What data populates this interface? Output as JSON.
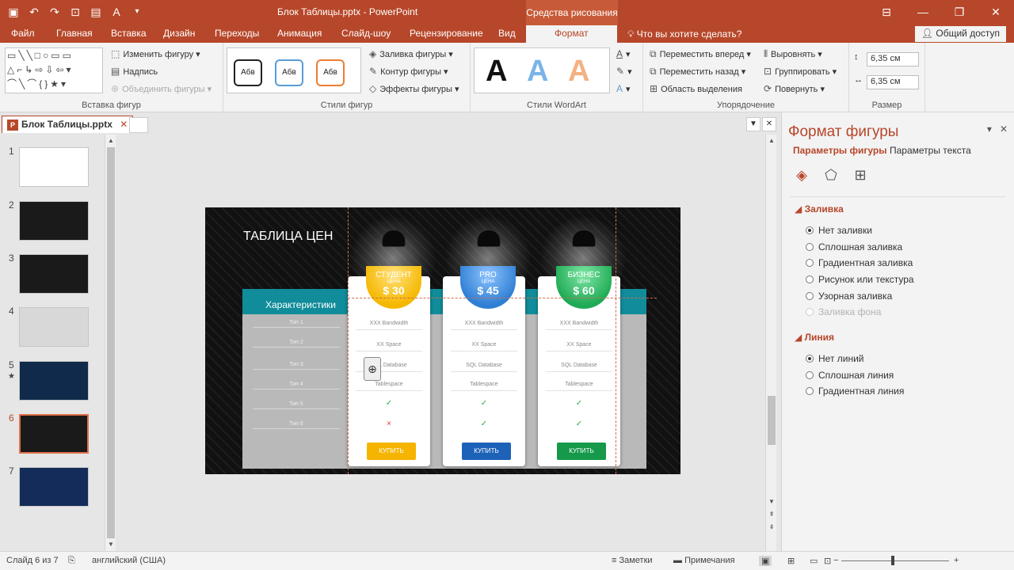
{
  "window": {
    "doc_title": "Блок Таблицы.pptx - PowerPoint",
    "context_group": "Средства рисования"
  },
  "tabs": [
    {
      "label": "Файл"
    },
    {
      "label": "Главная"
    },
    {
      "label": "Вставка"
    },
    {
      "label": "Дизайн"
    },
    {
      "label": "Переходы"
    },
    {
      "label": "Анимация"
    },
    {
      "label": "Слайд-шоу"
    },
    {
      "label": "Рецензирование"
    },
    {
      "label": "Вид"
    },
    {
      "label": "Формат"
    }
  ],
  "tellme": "Что вы хотите сделать?",
  "share": "Общий доступ",
  "ribbon": {
    "insert_shapes": {
      "edit_shape": "Изменить фигуру",
      "text_box": "Надпись",
      "merge_shapes": "Объединить фигуры",
      "label": "Вставка фигур"
    },
    "shape_styles": {
      "swatch_label": "Абв",
      "fill": "Заливка фигуры",
      "outline": "Контур фигуры",
      "effects": "Эффекты фигуры",
      "label": "Стили фигур"
    },
    "wordart": {
      "letter": "A",
      "label": "Стили WordArt"
    },
    "arrange": {
      "bring_forward": "Переместить вперед",
      "send_backward": "Переместить назад",
      "selection_pane": "Область выделения",
      "align": "Выровнять",
      "group": "Группировать",
      "rotate": "Повернуть",
      "label": "Упорядочение"
    },
    "size": {
      "height": "6,35 см",
      "width": "6,35 см",
      "label": "Размер"
    }
  },
  "file_tab": "Блок Таблицы.pptx",
  "thumbnails": [
    {
      "num": "1"
    },
    {
      "num": "2"
    },
    {
      "num": "3"
    },
    {
      "num": "4"
    },
    {
      "num": "5",
      "star": "★"
    },
    {
      "num": "6"
    },
    {
      "num": "7"
    }
  ],
  "slide": {
    "title": "ТАБЛИЦА ЦЕН",
    "features_header": "Характеристики",
    "feature_rows": [
      "Тип 1",
      "Тип 2",
      "Тип 3",
      "Тип 4",
      "Тип 5",
      "Тип 6"
    ],
    "card_lines": [
      "XXX Bandwidth",
      "XX Space",
      "SQL Database",
      "Tablespace"
    ],
    "check": "✓",
    "cross": "×",
    "price_label": "ЦЕНА",
    "plans": [
      {
        "name": "СТУДЕНТ",
        "price": "$ 30",
        "button": "КУПИТЬ",
        "color": "#f5b800",
        "button_color": "#f5b400"
      },
      {
        "name": "PRO",
        "price": "$ 45",
        "button": "КУПИТЬ",
        "color": "#2f7fd4",
        "button_color": "#1d62b8"
      },
      {
        "name": "БИЗНЕС",
        "price": "$ 60",
        "button": "КУПИТЬ",
        "color": "#1faa55",
        "button_color": "#16994a"
      }
    ]
  },
  "pane": {
    "title": "Формат фигуры",
    "tab_shape": "Параметры фигуры",
    "tab_text": "Параметры текста",
    "fill_section": "Заливка",
    "fill_options": [
      "Нет заливки",
      "Сплошная заливка",
      "Градиентная заливка",
      "Рисунок или текстура",
      "Узорная заливка",
      "Заливка фона"
    ],
    "line_section": "Линия",
    "line_options": [
      "Нет линий",
      "Сплошная линия",
      "Градиентная линия"
    ]
  },
  "status": {
    "slide_info": "Слайд 6 из 7",
    "language": "английский (США)",
    "notes": "Заметки",
    "comments": "Примечания"
  },
  "colors": {
    "accent": "#b7472a",
    "teal": "#118c9a"
  }
}
